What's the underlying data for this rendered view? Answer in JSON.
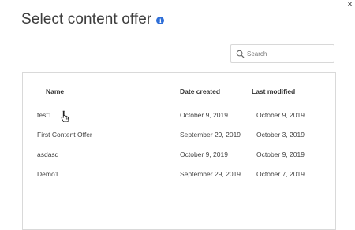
{
  "dialog": {
    "title": "Select content offer",
    "info_icon": "info-icon",
    "close_icon": "close-icon",
    "close_glyph": "×"
  },
  "search": {
    "placeholder": "Search",
    "icon": "search-icon"
  },
  "table": {
    "columns": [
      "Name",
      "Date created",
      "Last modified"
    ],
    "rows": [
      {
        "name": "test1",
        "created": "October 9, 2019",
        "modified": "October 9, 2019"
      },
      {
        "name": "First Content Offer",
        "created": "September 29, 2019",
        "modified": "October 3, 2019"
      },
      {
        "name": "asdasd",
        "created": "October 9, 2019",
        "modified": "October 9, 2019"
      },
      {
        "name": "Demo1",
        "created": "September 29, 2019",
        "modified": "October 7, 2019"
      }
    ]
  },
  "colors": {
    "accent": "#2f6fd8",
    "border": "#d9d9d9",
    "text": "#444444"
  }
}
